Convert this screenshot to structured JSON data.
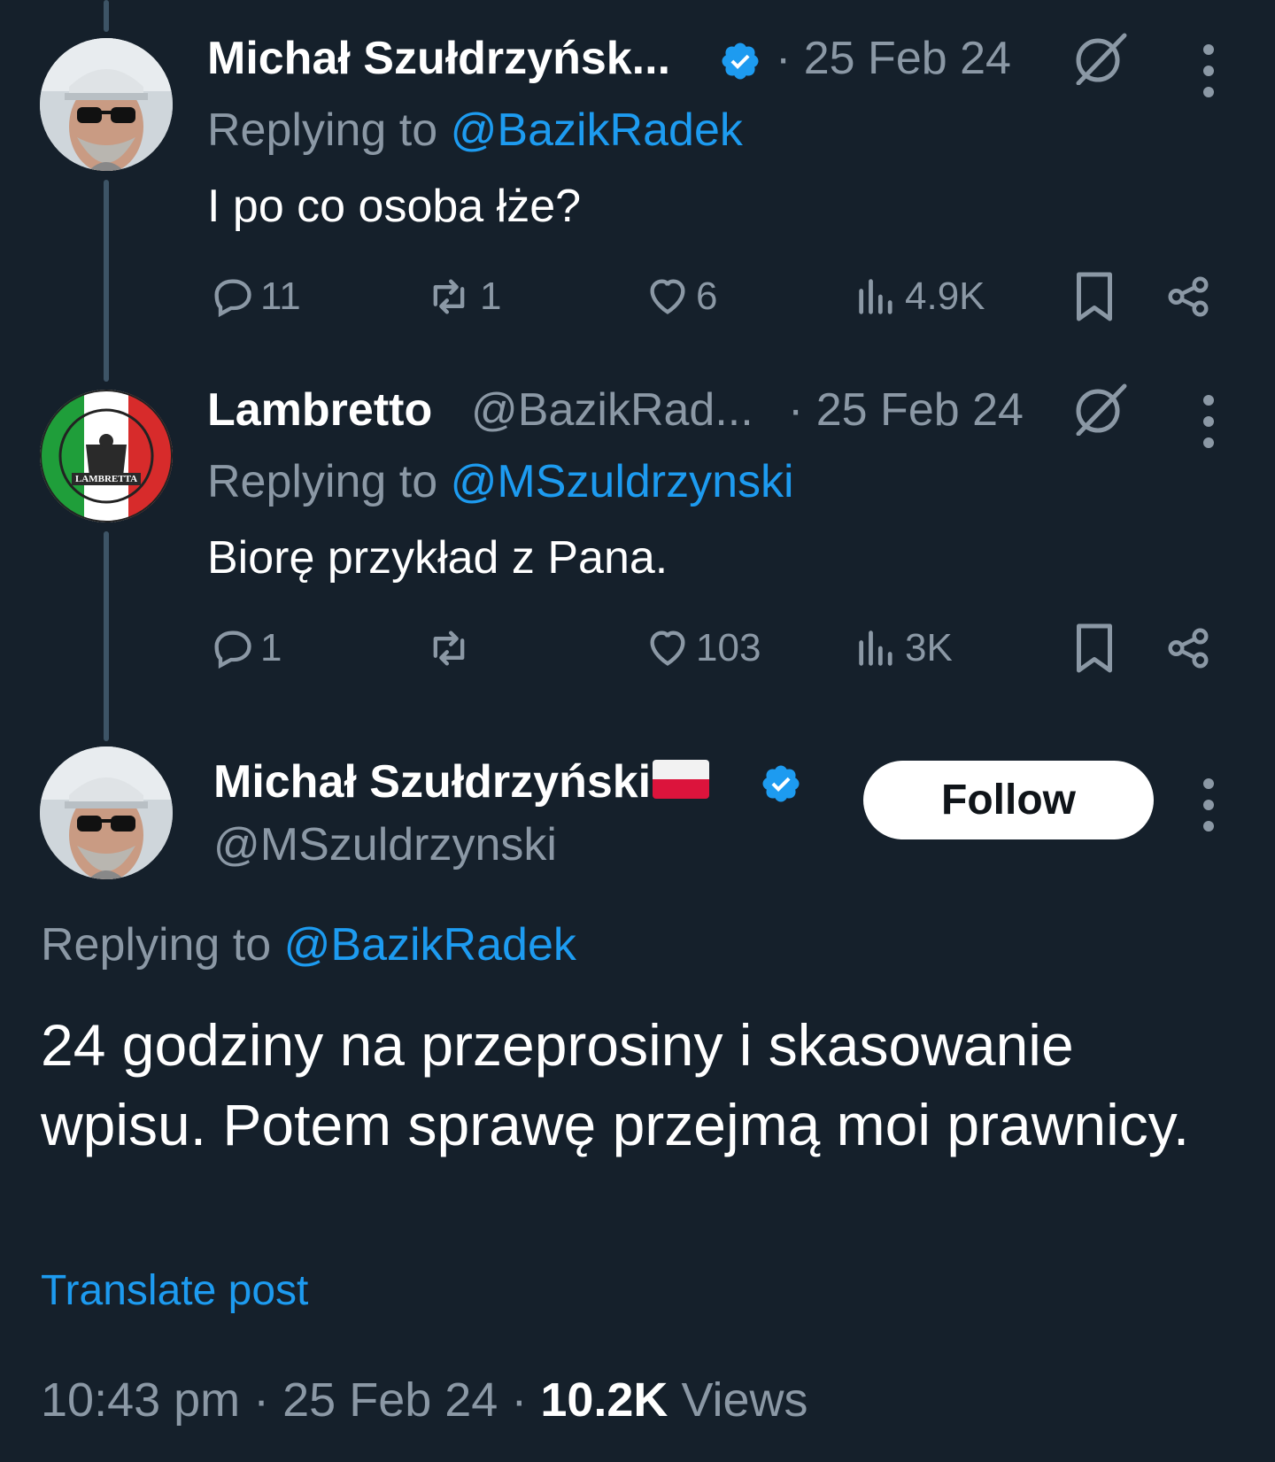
{
  "tweets": [
    {
      "name": "Michał Szułdrzyńsk...",
      "date": "· 25 Feb 24",
      "reply_prefix": "Replying to",
      "reply_to": "@BazikRadek",
      "text": "I po co osoba łże?",
      "replies": "11",
      "reposts": "1",
      "likes": "6",
      "views": "4.9K"
    },
    {
      "name": "Lambretto",
      "handle": "@BazikRad...",
      "date": "· 25 Feb 24",
      "reply_prefix": "Replying to",
      "reply_to": "@MSzuldrzynski",
      "text": "Biorę przykład z Pana.",
      "replies": "1",
      "reposts": "",
      "likes": "103",
      "views": "3K"
    }
  ],
  "main_tweet": {
    "name": "Michał Szułdrzyński",
    "handle": "@MSzuldrzynski",
    "follow_label": "Follow",
    "reply_prefix": "Replying to",
    "reply_to": "@BazikRadek",
    "text": "24 godziny na przeprosiny i skasowanie wpisu. Potem sprawę przejmą moi prawnicy.",
    "translate_label": "Translate post",
    "time": "10:43 pm · 25 Feb 24 ·",
    "views_count": "10.2K",
    "views_label": "Views"
  },
  "avatar_logo_text": "LAMBRETTA",
  "colors": {
    "background": "#15202b",
    "text_primary": "#ffffff",
    "text_secondary": "#8b98a5",
    "accent": "#1d9bf0",
    "thread_line": "#3d5466"
  },
  "icons": [
    "verified-badge-icon",
    "grok-icon",
    "more-icon",
    "reply-icon",
    "repost-icon",
    "like-icon",
    "views-icon",
    "bookmark-icon",
    "share-icon",
    "poland-flag-icon"
  ]
}
